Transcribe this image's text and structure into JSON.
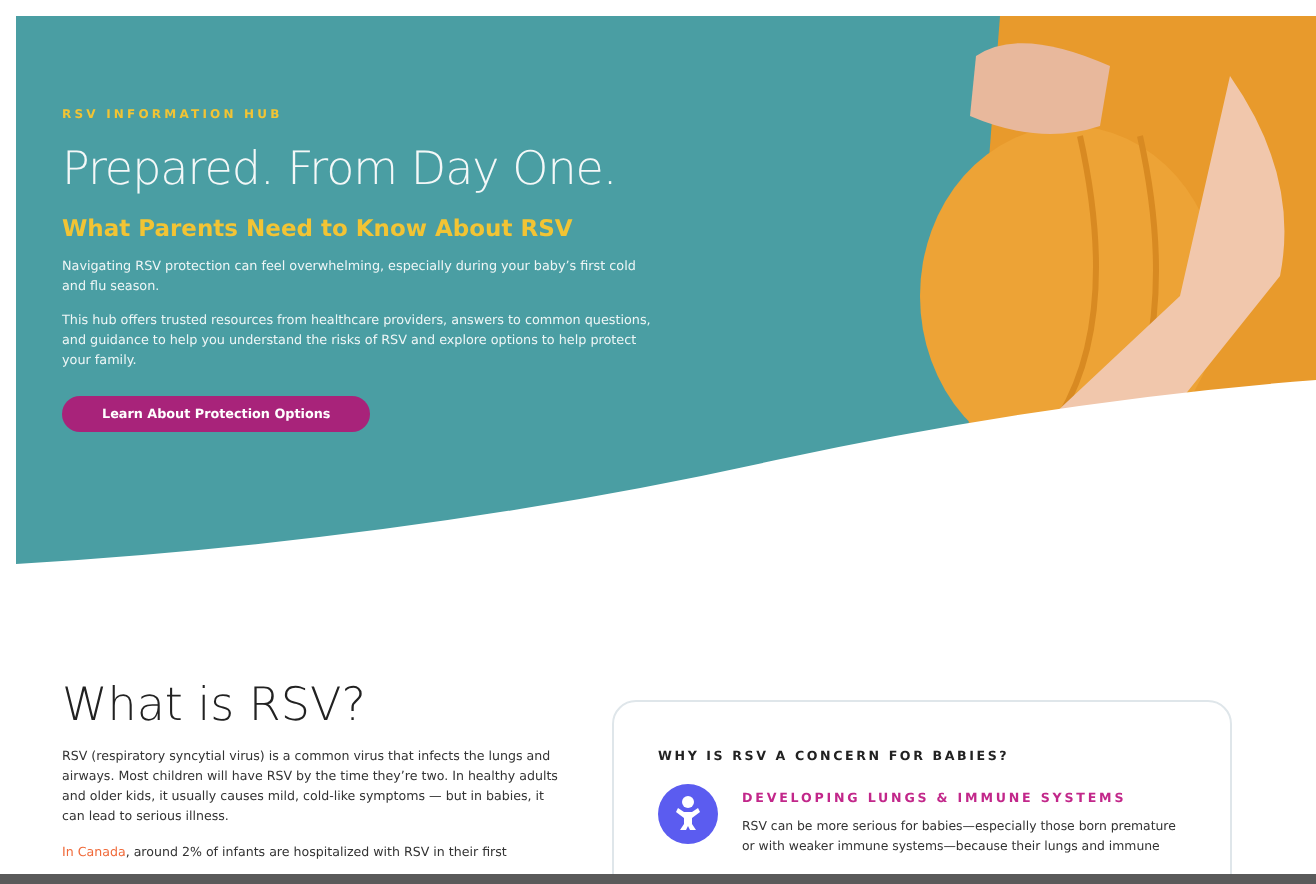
{
  "hero": {
    "eyebrow": "RSV INFORMATION HUB",
    "title": "Prepared. From Day One.",
    "subtitle": "What Parents Need to Know About RSV",
    "paragraphs": [
      "Navigating RSV protection can feel overwhelming, especially during your baby’s first cold and flu season.",
      "This hub offers trusted resources from healthcare providers, answers to common questions, and guidance to help you understand the risks of RSV and explore options to help protect your family."
    ],
    "button": "Learn About Protection Options"
  },
  "about": {
    "title": "What is RSV?",
    "paragraphs": [
      "RSV (respiratory syncytial virus) is a common virus that infects the lungs and airways. Most children will have RSV by the time they’re two. In healthy adults and older kids, it usually causes mild, cold-like symptoms — but in babies, it can lead to serious illness."
    ],
    "highlight": {
      "link": "In Canada",
      "text": ", around 2% of infants are hospitalized with RSV in their first"
    }
  },
  "card": {
    "title": "WHY IS RSV A CONCERN FOR BABIES?",
    "items": [
      {
        "heading": "DEVELOPING LUNGS & IMMUNE SYSTEMS",
        "lines": [
          "RSV can be more serious for babies—especially those born premature",
          "or with weaker immune systems—because their lungs and immune"
        ]
      }
    ]
  }
}
